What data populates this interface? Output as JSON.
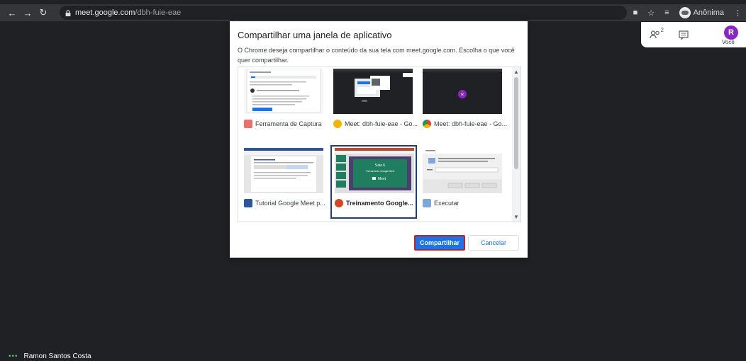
{
  "browser": {
    "url_host": "meet.google.com",
    "url_path": "/dbh-fuie-eae",
    "profile_label": "Anônima"
  },
  "meet": {
    "people_count": "2",
    "avatar_initial": "R",
    "avatar_caption": "Você",
    "participant_name": "Ramon Santos Costa"
  },
  "dialog": {
    "title": "Compartilhar uma janela de aplicativo",
    "description": "O Chrome deseja compartilhar o conteúdo da sua tela com meet.google.com. Escolha o que você quer compartilhar.",
    "windows": [
      {
        "label": "Ferramenta de Captura",
        "icon": "snipping-tool-icon",
        "color": "#e8716d"
      },
      {
        "label": "Meet: dbh-fuie-eae - Go...",
        "icon": "chrome-canary-icon",
        "color": "#f4b400"
      },
      {
        "label": "Meet: dbh-fuie-eae - Go...",
        "icon": "chrome-icon",
        "color": "#db4437"
      },
      {
        "label": "Tutorial Google Meet p...",
        "icon": "word-icon",
        "color": "#2b579a"
      },
      {
        "label": "Treinamento Google...",
        "icon": "powerpoint-icon",
        "color": "#d24726",
        "selected": true
      },
      {
        "label": "Executar",
        "icon": "run-icon",
        "color": "#7ea6d8"
      }
    ],
    "thumb_texts": {
      "ppt_title": "Sala 6",
      "ppt_sub": "Treinamento Google Meet",
      "ppt_meet": "Meet"
    },
    "share_label": "Compartilhar",
    "cancel_label": "Cancelar"
  }
}
